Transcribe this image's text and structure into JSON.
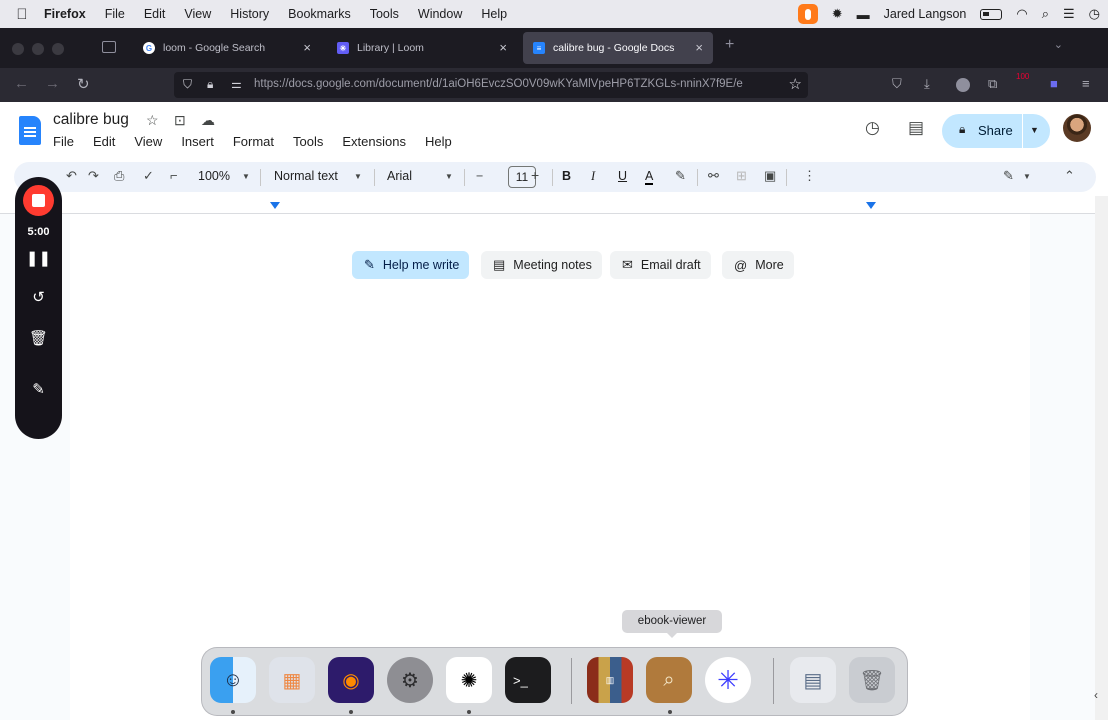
{
  "menubar": {
    "apple": "",
    "app": "Firefox",
    "items": [
      "File",
      "Edit",
      "View",
      "History",
      "Bookmarks",
      "Tools",
      "Window",
      "Help"
    ],
    "user": "Jared Langson",
    "icons": [
      "microphone-icon",
      "brightness-icon",
      "screen-record-icon",
      "battery-icon",
      "wifi-icon",
      "search-icon",
      "control-center-icon",
      "clock-icon"
    ]
  },
  "browser": {
    "tabs": [
      {
        "title": "loom - Google Search",
        "favicon": "G",
        "active": false
      },
      {
        "title": "Library | Loom",
        "favicon": "✳",
        "active": false
      },
      {
        "title": "calibre bug - Google Docs",
        "favicon": "≡",
        "active": true
      }
    ],
    "new_tab": "+",
    "url_host": "https://docs.google.com",
    "url_path": "/document/d/1aiOH6EvczSO0V09wKYaMlVpeHP6TZKGLs-nninX7f9E/e",
    "toolbar_badge": "100"
  },
  "docs": {
    "title": "calibre bug",
    "menu": [
      "File",
      "Edit",
      "View",
      "Insert",
      "Format",
      "Tools",
      "Extensions",
      "Help"
    ],
    "share_label": "Share",
    "toolbar": {
      "zoom": "100%",
      "style": "Normal text",
      "font": "Arial",
      "minus": "−",
      "font_size": "11",
      "plus": "+",
      "bold": "B",
      "italic": "I",
      "underline": "U",
      "text_color": "A"
    },
    "chips": [
      {
        "label": "Help me write",
        "icon": "✎",
        "primary": true
      },
      {
        "label": "Meeting notes",
        "icon": "▤",
        "primary": false
      },
      {
        "label": "Email draft",
        "icon": "✉",
        "primary": false
      },
      {
        "label": "More",
        "icon": "@",
        "primary": false
      }
    ]
  },
  "loom": {
    "timer": "5:00"
  },
  "dock": {
    "tooltip": "ebook-viewer",
    "apps": [
      "Finder",
      "Launchpad",
      "Firefox",
      "System Settings",
      "OpenAI",
      "Terminal",
      "calibre",
      "ebook-viewer",
      "Perplexity",
      "Preview",
      "Trash"
    ]
  },
  "colors": {
    "firefox_tabstrip": "#1c1b22",
    "firefox_navbar": "#2b2a33",
    "docs_blue": "#2684fc",
    "share_bg": "#c2e7ff",
    "toolbar_bg": "#edf2fa",
    "loom_record": "#ff3b30",
    "mic_orange": "#ff7a1a"
  }
}
